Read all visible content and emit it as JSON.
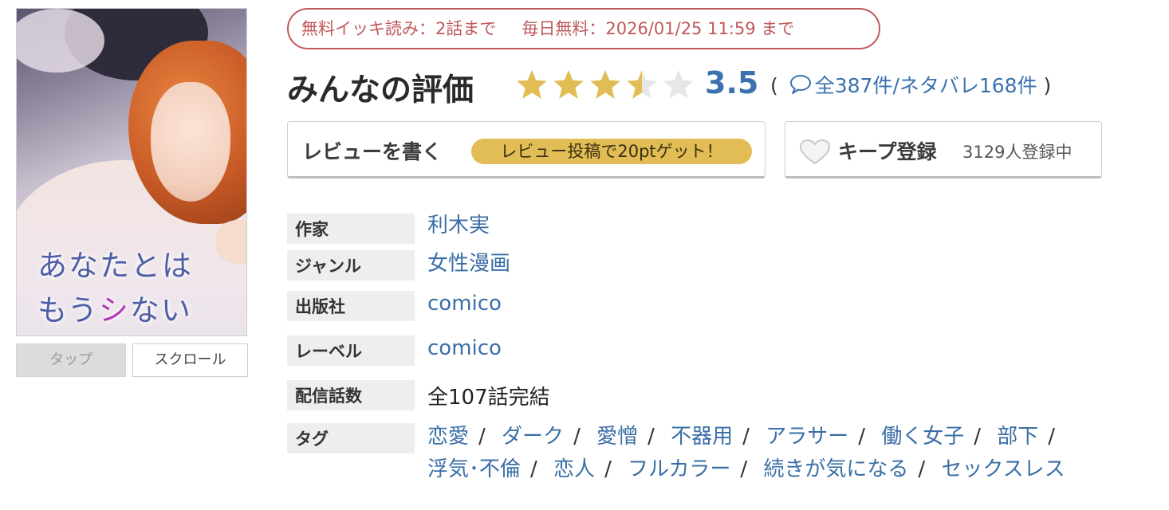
{
  "cover": {
    "title_line1": "あなたとは",
    "title_line2_a": "もう",
    "title_line2_mark": "シ",
    "title_line2_b": "ない",
    "tap_label": "タップ",
    "scroll_label": "スクロール"
  },
  "campaign": {
    "free_read": "無料イッキ読み：2話まで",
    "daily_free": "毎日無料：2026/01/25 11:59 まで"
  },
  "rating": {
    "title": "みんなの評価",
    "score": "3.5",
    "value": 3.5,
    "max": 5,
    "open_paren": "(",
    "total": "全387件",
    "divider": "/",
    "spoilers": "ネタバレ168件",
    "close_paren": ")"
  },
  "actions": {
    "write_review": "レビューを書く",
    "review_promo": "レビュー投稿で20ptゲット！",
    "keep_label": "キープ登録",
    "keep_count": "3129人登録中"
  },
  "info": {
    "author_label": "作家",
    "author": "利木実",
    "genre_label": "ジャンル",
    "genre": "女性漫画",
    "publisher_label": "出版社",
    "publisher": "comico",
    "label_label": "レーベル",
    "label": "comico",
    "episodes_label": "配信話数",
    "episodes": "全107話完結",
    "tags_label": "タグ",
    "tags": [
      "恋愛",
      "ダーク",
      "愛憎",
      "不器用",
      "アラサー",
      "働く女子",
      "部下",
      "浮気･不倫",
      "恋人",
      "フルカラー",
      "続きが気になる",
      "セックスレス"
    ]
  },
  "colors": {
    "link": "#3b6fa6",
    "score": "#3b72ad",
    "campaign": "#c0585a",
    "star_on": "#e2bd55",
    "star_off": "#e6e6e6",
    "promo": "#e2bd55"
  }
}
